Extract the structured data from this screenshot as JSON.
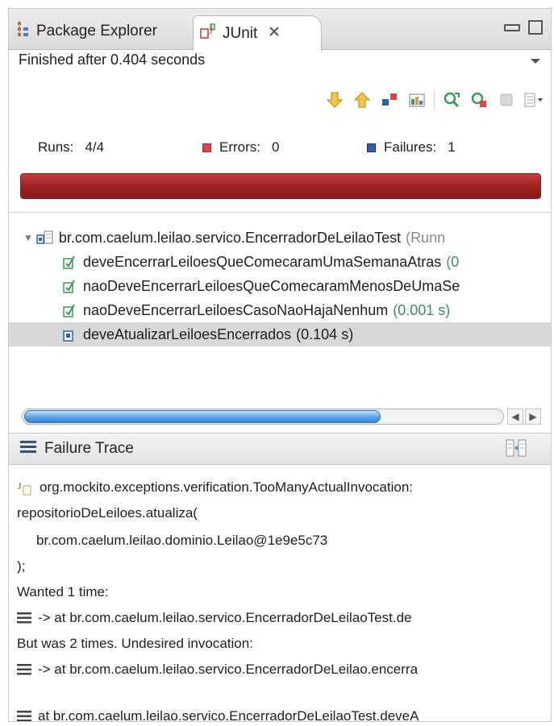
{
  "tabs": {
    "package_explorer": "Package Explorer",
    "junit": "JUnit"
  },
  "status": "Finished after 0.404 seconds",
  "counters": {
    "runs_label": "Runs:",
    "runs_value": "4/4",
    "errors_label": "Errors:",
    "errors_value": "0",
    "failures_label": "Failures:",
    "failures_value": "1"
  },
  "progress": {
    "fraction": 1.0,
    "status_color": "#9c2222"
  },
  "tree": {
    "suite_name": "br.com.caelum.leilao.servico.EncerradorDeLeilaoTest",
    "suite_suffix": "(Runn",
    "tests": [
      {
        "name": "deveEncerrarLeiloesQueComecaramUmaSemanaAtras",
        "time": "(0"
      },
      {
        "name": "naoDeveEncerrarLeiloesQueComecaramMenosDeUmaSe",
        "time": ""
      },
      {
        "name": "naoDeveEncerrarLeiloesCasoNaoHajaNenhum",
        "time": "(0.001 s)"
      },
      {
        "name": "deveAtualizarLeiloesEncerrados",
        "time": "(0.104 s)"
      }
    ]
  },
  "trace": {
    "title": "Failure Trace",
    "lines": [
      "org.mockito.exceptions.verification.TooManyActualInvocation:",
      "repositorioDeLeiloes.atualiza(",
      "br.com.caelum.leilao.dominio.Leilao@1e9e5c73",
      ");",
      "Wanted 1 time:",
      "-> at br.com.caelum.leilao.servico.EncerradorDeLeilaoTest.de",
      "But was 2 times. Undesired invocation:",
      "-> at br.com.caelum.leilao.servico.EncerradorDeLeilao.encerra",
      "at br.com.caelum.leilao.servico.EncerradorDeLeilaoTest.deveA"
    ]
  },
  "colors": {
    "error_marker": "#d6464a",
    "failure_marker": "#2d5fae",
    "scroll_thumb": "#5aa3e6",
    "test_pass_icon": "#3c9a55"
  },
  "icons": {
    "package_explorer_tab": "package-explorer-icon",
    "junit_tab": "junit-icon",
    "close_tab": "close-icon",
    "minimize": "minimize-icon",
    "maximize": "maximize-icon",
    "view_menu": "chevron-down-icon",
    "toolbar": [
      "next-failure-icon",
      "previous-failure-icon",
      "show-failures-only-icon",
      "scroll-lock-icon",
      "rerun-test-icon",
      "rerun-failed-first-icon",
      "stop-icon",
      "history-icon"
    ],
    "failure_trace": "stack-trace-icon",
    "compare": "compare-result-icon",
    "stack_frame": "stack-frame-icon"
  }
}
